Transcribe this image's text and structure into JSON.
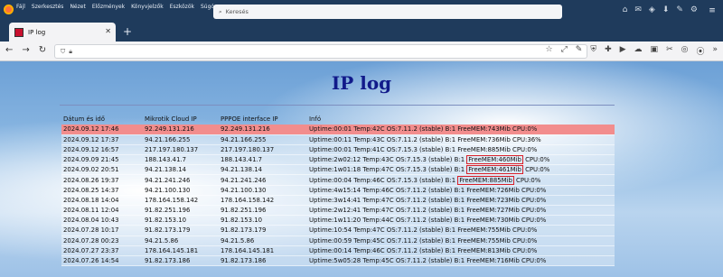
{
  "menu": [
    "Fájl",
    "Szerkesztés",
    "Nézet",
    "Előzmények",
    "Könyvjelzők",
    "Eszközök",
    "Súgó"
  ],
  "search": {
    "placeholder": "Keresés"
  },
  "tab": {
    "title": "IP log"
  },
  "page": {
    "title": "IP log"
  },
  "table": {
    "headers": [
      "Dátum és idő",
      "Mikrotik Cloud IP",
      "PPPOE interface IP",
      "Infó"
    ],
    "rows": [
      {
        "date": "2024.09.12 17:46",
        "cloud_ip": "92.249.131.216",
        "pppoe_ip": "92.249.131.216",
        "info_a": "Uptime:00:01 Temp:42C OS:7.11.2 (stable) B:1 ",
        "info_box": "",
        "info_b": "FreeMEM:743Mib CPU:0%"
      },
      {
        "date": "2024.09.12 17:37",
        "cloud_ip": "94.21.166.255",
        "pppoe_ip": "94.21.166.255",
        "info_a": "Uptime:00:11 Temp:43C OS:7.11.2 (stable) B:1 ",
        "info_box": "",
        "info_b": "FreeMEM:736Mib CPU:36%"
      },
      {
        "date": "2024.09.12 16:57",
        "cloud_ip": "217.197.180.137",
        "pppoe_ip": "217.197.180.137",
        "info_a": "Uptime:00:01 Temp:41C OS:7.15.3 (stable) B:1 ",
        "info_box": "",
        "info_b": "FreeMEM:885Mib CPU:0%"
      },
      {
        "date": "2024.09.09 21:45",
        "cloud_ip": "188.143.41.7",
        "pppoe_ip": "188.143.41.7",
        "info_a": "Uptime:2w02:12 Temp:43C OS:7.15.3 (stable) B:1 ",
        "info_box": "FreeMEM:460Mib",
        "info_b": " CPU:0%"
      },
      {
        "date": "2024.09.02 20:51",
        "cloud_ip": "94.21.138.14",
        "pppoe_ip": "94.21.138.14",
        "info_a": "Uptime:1w01:18 Temp:47C OS:7.15.3 (stable) B:1 ",
        "info_box": "FreeMEM:461Mib",
        "info_b": " CPU:0%"
      },
      {
        "date": "2024.08.26 19:37",
        "cloud_ip": "94.21.241.246",
        "pppoe_ip": "94.21.241.246",
        "info_a": "Uptime:00:04 Temp:46C OS:7.15.3 (stable) B:1 ",
        "info_box": "FreeMEM:885Mib",
        "info_b": " CPU:0%"
      },
      {
        "date": "2024.08.25 14:37",
        "cloud_ip": "94.21.100.130",
        "pppoe_ip": "94.21.100.130",
        "info_a": "Uptime:4w15:14 Temp:46C OS:7.11.2 (stable) B:1 ",
        "info_box": "",
        "info_b": "FreeMEM:726Mib CPU:0%"
      },
      {
        "date": "2024.08.18 14:04",
        "cloud_ip": "178.164.158.142",
        "pppoe_ip": "178.164.158.142",
        "info_a": "Uptime:3w14:41 Temp:47C OS:7.11.2 (stable) B:1 ",
        "info_box": "",
        "info_b": "FreeMEM:723Mib CPU:0%"
      },
      {
        "date": "2024.08.11 12:04",
        "cloud_ip": "91.82.251.196",
        "pppoe_ip": "91.82.251.196",
        "info_a": "Uptime:2w12:41 Temp:47C OS:7.11.2 (stable) B:1 ",
        "info_box": "",
        "info_b": "FreeMEM:727Mib CPU:0%"
      },
      {
        "date": "2024.08.04 10:43",
        "cloud_ip": "91.82.153.10",
        "pppoe_ip": "91.82.153.10",
        "info_a": "Uptime:1w11:20 Temp:44C OS:7.11.2 (stable) B:1 ",
        "info_box": "",
        "info_b": "FreeMEM:730Mib CPU:0%"
      },
      {
        "date": "2024.07.28 10:17",
        "cloud_ip": "91.82.173.179",
        "pppoe_ip": "91.82.173.179",
        "info_a": "Uptime:10:54 Temp:47C OS:7.11.2 (stable) B:1 ",
        "info_box": "",
        "info_b": "FreeMEM:755Mib CPU:0%"
      },
      {
        "date": "2024.07.28 00:23",
        "cloud_ip": "94.21.5.86",
        "pppoe_ip": "94.21.5.86",
        "info_a": "Uptime:00:59 Temp:45C OS:7.11.2 (stable) B:1 ",
        "info_box": "",
        "info_b": "FreeMEM:755Mib CPU:0%"
      },
      {
        "date": "2024.07.27 23:37",
        "cloud_ip": "178.164.145.181",
        "pppoe_ip": "178.164.145.181",
        "info_a": "Uptime:00:14 Temp:46C OS:7.11.2 (stable) B:1 ",
        "info_box": "",
        "info_b": "FreeMEM:813Mib CPU:0%"
      },
      {
        "date": "2024.07.26 14:54",
        "cloud_ip": "91.82.173.186",
        "pppoe_ip": "91.82.173.186",
        "info_a": "Uptime:5w05:28 Temp:45C OS:7.11.2 (stable) B:1 ",
        "info_box": "",
        "info_b": "FreeMEM:716Mib CPU:0%"
      }
    ]
  },
  "colors": {
    "highlight_row": "#f28d8d",
    "title": "#111a8a",
    "box": "#d8202a"
  }
}
